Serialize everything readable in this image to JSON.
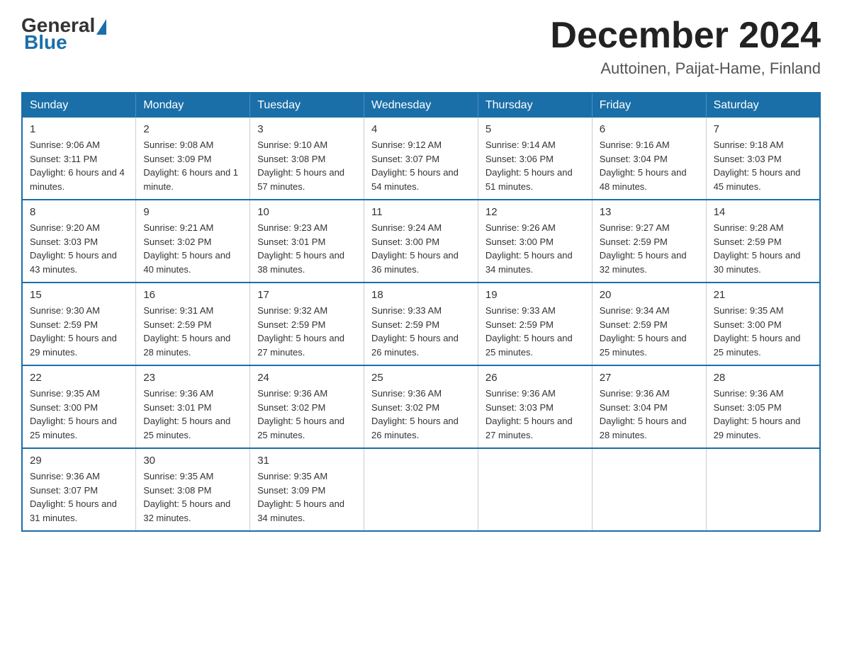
{
  "header": {
    "logo_general": "General",
    "logo_blue": "Blue",
    "month_title": "December 2024",
    "location": "Auttoinen, Paijat-Hame, Finland"
  },
  "weekdays": [
    "Sunday",
    "Monday",
    "Tuesday",
    "Wednesday",
    "Thursday",
    "Friday",
    "Saturday"
  ],
  "weeks": [
    [
      {
        "day": "1",
        "sunrise": "9:06 AM",
        "sunset": "3:11 PM",
        "daylight": "6 hours and 4 minutes."
      },
      {
        "day": "2",
        "sunrise": "9:08 AM",
        "sunset": "3:09 PM",
        "daylight": "6 hours and 1 minute."
      },
      {
        "day": "3",
        "sunrise": "9:10 AM",
        "sunset": "3:08 PM",
        "daylight": "5 hours and 57 minutes."
      },
      {
        "day": "4",
        "sunrise": "9:12 AM",
        "sunset": "3:07 PM",
        "daylight": "5 hours and 54 minutes."
      },
      {
        "day": "5",
        "sunrise": "9:14 AM",
        "sunset": "3:06 PM",
        "daylight": "5 hours and 51 minutes."
      },
      {
        "day": "6",
        "sunrise": "9:16 AM",
        "sunset": "3:04 PM",
        "daylight": "5 hours and 48 minutes."
      },
      {
        "day": "7",
        "sunrise": "9:18 AM",
        "sunset": "3:03 PM",
        "daylight": "5 hours and 45 minutes."
      }
    ],
    [
      {
        "day": "8",
        "sunrise": "9:20 AM",
        "sunset": "3:03 PM",
        "daylight": "5 hours and 43 minutes."
      },
      {
        "day": "9",
        "sunrise": "9:21 AM",
        "sunset": "3:02 PM",
        "daylight": "5 hours and 40 minutes."
      },
      {
        "day": "10",
        "sunrise": "9:23 AM",
        "sunset": "3:01 PM",
        "daylight": "5 hours and 38 minutes."
      },
      {
        "day": "11",
        "sunrise": "9:24 AM",
        "sunset": "3:00 PM",
        "daylight": "5 hours and 36 minutes."
      },
      {
        "day": "12",
        "sunrise": "9:26 AM",
        "sunset": "3:00 PM",
        "daylight": "5 hours and 34 minutes."
      },
      {
        "day": "13",
        "sunrise": "9:27 AM",
        "sunset": "2:59 PM",
        "daylight": "5 hours and 32 minutes."
      },
      {
        "day": "14",
        "sunrise": "9:28 AM",
        "sunset": "2:59 PM",
        "daylight": "5 hours and 30 minutes."
      }
    ],
    [
      {
        "day": "15",
        "sunrise": "9:30 AM",
        "sunset": "2:59 PM",
        "daylight": "5 hours and 29 minutes."
      },
      {
        "day": "16",
        "sunrise": "9:31 AM",
        "sunset": "2:59 PM",
        "daylight": "5 hours and 28 minutes."
      },
      {
        "day": "17",
        "sunrise": "9:32 AM",
        "sunset": "2:59 PM",
        "daylight": "5 hours and 27 minutes."
      },
      {
        "day": "18",
        "sunrise": "9:33 AM",
        "sunset": "2:59 PM",
        "daylight": "5 hours and 26 minutes."
      },
      {
        "day": "19",
        "sunrise": "9:33 AM",
        "sunset": "2:59 PM",
        "daylight": "5 hours and 25 minutes."
      },
      {
        "day": "20",
        "sunrise": "9:34 AM",
        "sunset": "2:59 PM",
        "daylight": "5 hours and 25 minutes."
      },
      {
        "day": "21",
        "sunrise": "9:35 AM",
        "sunset": "3:00 PM",
        "daylight": "5 hours and 25 minutes."
      }
    ],
    [
      {
        "day": "22",
        "sunrise": "9:35 AM",
        "sunset": "3:00 PM",
        "daylight": "5 hours and 25 minutes."
      },
      {
        "day": "23",
        "sunrise": "9:36 AM",
        "sunset": "3:01 PM",
        "daylight": "5 hours and 25 minutes."
      },
      {
        "day": "24",
        "sunrise": "9:36 AM",
        "sunset": "3:02 PM",
        "daylight": "5 hours and 25 minutes."
      },
      {
        "day": "25",
        "sunrise": "9:36 AM",
        "sunset": "3:02 PM",
        "daylight": "5 hours and 26 minutes."
      },
      {
        "day": "26",
        "sunrise": "9:36 AM",
        "sunset": "3:03 PM",
        "daylight": "5 hours and 27 minutes."
      },
      {
        "day": "27",
        "sunrise": "9:36 AM",
        "sunset": "3:04 PM",
        "daylight": "5 hours and 28 minutes."
      },
      {
        "day": "28",
        "sunrise": "9:36 AM",
        "sunset": "3:05 PM",
        "daylight": "5 hours and 29 minutes."
      }
    ],
    [
      {
        "day": "29",
        "sunrise": "9:36 AM",
        "sunset": "3:07 PM",
        "daylight": "5 hours and 31 minutes."
      },
      {
        "day": "30",
        "sunrise": "9:35 AM",
        "sunset": "3:08 PM",
        "daylight": "5 hours and 32 minutes."
      },
      {
        "day": "31",
        "sunrise": "9:35 AM",
        "sunset": "3:09 PM",
        "daylight": "5 hours and 34 minutes."
      },
      null,
      null,
      null,
      null
    ]
  ]
}
